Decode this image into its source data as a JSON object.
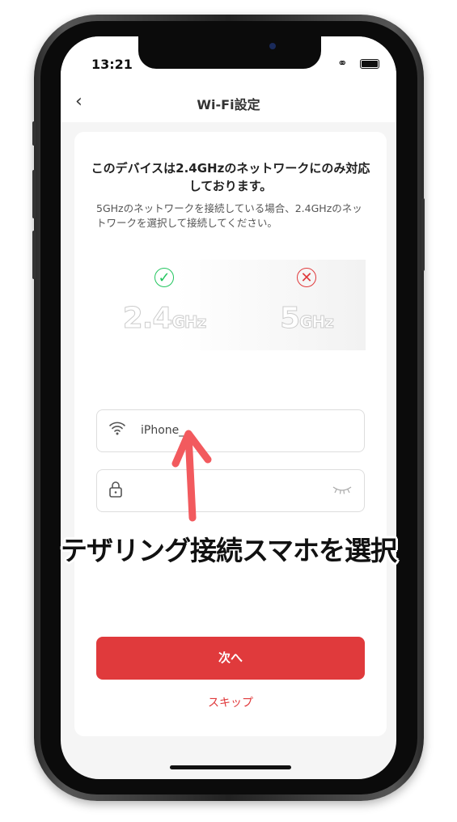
{
  "status_bar": {
    "time": "13:21"
  },
  "header": {
    "title": "Wi-Fi設定",
    "back_icon": "chevron-left-icon"
  },
  "card": {
    "heading": "このデバイスは2.4GHzのネットワークにのみ対応しております。",
    "description": "5GHzのネットワークを接続している場合、2.4GHzのネットワークを選択して接続してください。",
    "bands": [
      {
        "num": "2.4",
        "unit": "GHz",
        "status": "supported",
        "icon": "check-circle-icon",
        "color": "#22c55e"
      },
      {
        "num": "5",
        "unit": "GHz",
        "status": "unsupported",
        "icon": "x-circle-icon",
        "color": "#e03a3c"
      }
    ],
    "ssid_value": "iPhone_",
    "password_value": "",
    "next_label": "次へ",
    "skip_label": "スキップ"
  },
  "annotation": {
    "caption": "テザリング接続スマホを選択",
    "arrow_color": "#f25a5e"
  },
  "colors": {
    "accent": "#e03a3c"
  }
}
